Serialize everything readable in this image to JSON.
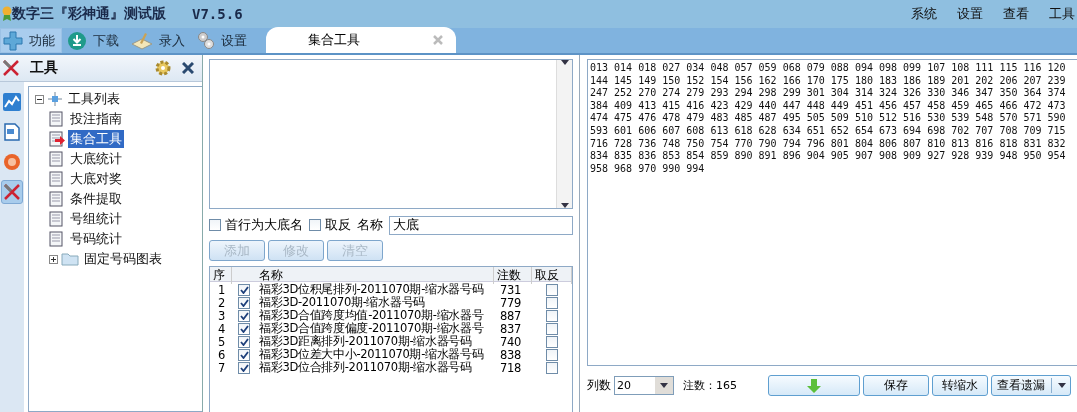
{
  "window": {
    "title": "数字三『彩神通』测试版",
    "version": "V7.5.6"
  },
  "menu": [
    "系统",
    "设置",
    "查看",
    "工具"
  ],
  "toolbar": [
    {
      "label": "功能",
      "selected": true
    },
    {
      "label": "下载",
      "selected": false
    },
    {
      "label": "录入",
      "selected": false
    },
    {
      "label": "设置",
      "selected": false
    }
  ],
  "tabs": [
    {
      "label": "集合工具",
      "selected": true
    }
  ],
  "sidebar": {
    "title": "工具",
    "strip": [
      {
        "selected": false
      },
      {
        "selected": false
      },
      {
        "selected": false
      },
      {
        "selected": true
      }
    ],
    "tree": [
      {
        "label": "工具列表",
        "expanded": true,
        "children": [
          {
            "label": "投注指南",
            "selected": false
          },
          {
            "label": "集合工具",
            "selected": true
          },
          {
            "label": "大底统计",
            "selected": false
          },
          {
            "label": "大底对奖",
            "selected": false
          },
          {
            "label": "条件提取",
            "selected": false
          },
          {
            "label": "号组统计",
            "selected": false
          },
          {
            "label": "号码统计",
            "selected": false
          },
          {
            "label": "固定号码图表",
            "expanded": false,
            "kind": "folder"
          }
        ]
      }
    ]
  },
  "editor": {
    "first_row_name": {
      "label": "首行为大底名",
      "checked": false
    },
    "invert": {
      "label": "取反",
      "checked": false
    },
    "name_label": "名称",
    "name_value": "大底",
    "buttons": [
      {
        "label": "添加",
        "disabled": true
      },
      {
        "label": "修改",
        "disabled": true
      },
      {
        "label": "清空",
        "disabled": true
      }
    ]
  },
  "table": {
    "columns": [
      "序",
      "名称",
      "注数",
      "取反"
    ],
    "rows": [
      {
        "index": "1",
        "checked": true,
        "name": "福彩3D位积尾排列-2011070期-缩水器号码",
        "count": "731",
        "invert": false
      },
      {
        "index": "2",
        "checked": true,
        "name": "福彩3D-2011070期-缩水器号码",
        "count": "779",
        "invert": false
      },
      {
        "index": "3",
        "checked": true,
        "name": "福彩3D合值跨度均值-2011070期-缩水器号",
        "count": "887",
        "invert": false
      },
      {
        "index": "4",
        "checked": true,
        "name": "福彩3D合值跨度偏度-2011070期-缩水器号",
        "count": "837",
        "invert": false
      },
      {
        "index": "5",
        "checked": true,
        "name": "福彩3D距离排列-2011070期-缩水器号码",
        "count": "740",
        "invert": false
      },
      {
        "index": "6",
        "checked": true,
        "name": "福彩3D位差大中小-2011070期-缩水器号码",
        "count": "838",
        "invert": false
      },
      {
        "index": "7",
        "checked": true,
        "name": "福彩3D位合排列-2011070期-缩水器号码",
        "count": "718",
        "invert": false
      }
    ]
  },
  "result": {
    "lines": [
      "013 014 018 027 034 048 057 059 068 079 088 094 098 099 107 108 111 115 116 120",
      "144 145 149 150 152 154 156 162 166 170 175 180 183 186 189 201 202 206 207 239",
      "247 252 270 274 279 293 294 298 299 301 304 314 324 326 330 346 347 350 364 374",
      "384 409 413 415 416 423 429 440 447 448 449 451 456 457 458 459 465 466 472 473",
      "474 475 476 478 479 483 485 487 495 505 509 510 512 516 530 539 548 570 571 590",
      "593 601 606 607 608 613 618 628 634 651 652 654 673 694 698 702 707 708 709 715",
      "716 728 736 748 750 754 770 790 794 796 801 804 806 807 810 813 816 818 831 832",
      "834 835 836 853 854 859 890 891 896 904 905 907 908 909 927 928 939 948 950 954",
      "958 968 970 990 994"
    ],
    "columns_label": "列数",
    "columns_value": "20",
    "count_label": "注数：",
    "count_value": "165",
    "buttons": [
      {
        "kind": "icon"
      },
      {
        "kind": "text",
        "label": "保存"
      },
      {
        "kind": "text",
        "label": "转缩水"
      },
      {
        "kind": "split",
        "label": "查看遗漏"
      }
    ]
  }
}
